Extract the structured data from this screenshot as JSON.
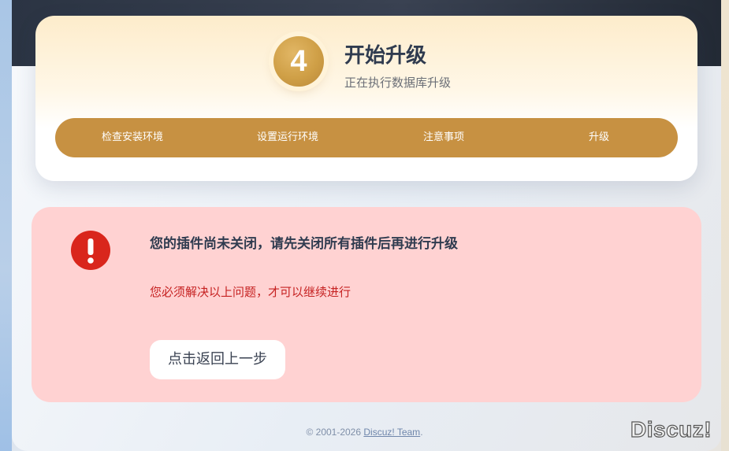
{
  "header": {
    "step_number": "4",
    "title": "开始升级",
    "subtitle": "正在执行数据库升级"
  },
  "steps": [
    {
      "label": "检查安装环境"
    },
    {
      "label": "设置运行环境"
    },
    {
      "label": "注意事项"
    },
    {
      "label": "升级"
    }
  ],
  "alert": {
    "icon": "exclamation-circle-icon",
    "title": "您的插件尚未关闭，请先关闭所有插件后再进行升级",
    "message": "您必须解决以上问题，才可以继续进行",
    "back_button_label": "点击返回上一步"
  },
  "footer": {
    "copyright_prefix": "© 2001-2026 ",
    "team_link": "Discuz! Team",
    "suffix": "."
  },
  "watermark": "Discuz!",
  "colors": {
    "accent_gold": "#c79142",
    "alert_background": "#ffd2d2",
    "alert_text": "#c62222",
    "error_icon": "#d9261c",
    "topbar": "#2b3443"
  }
}
